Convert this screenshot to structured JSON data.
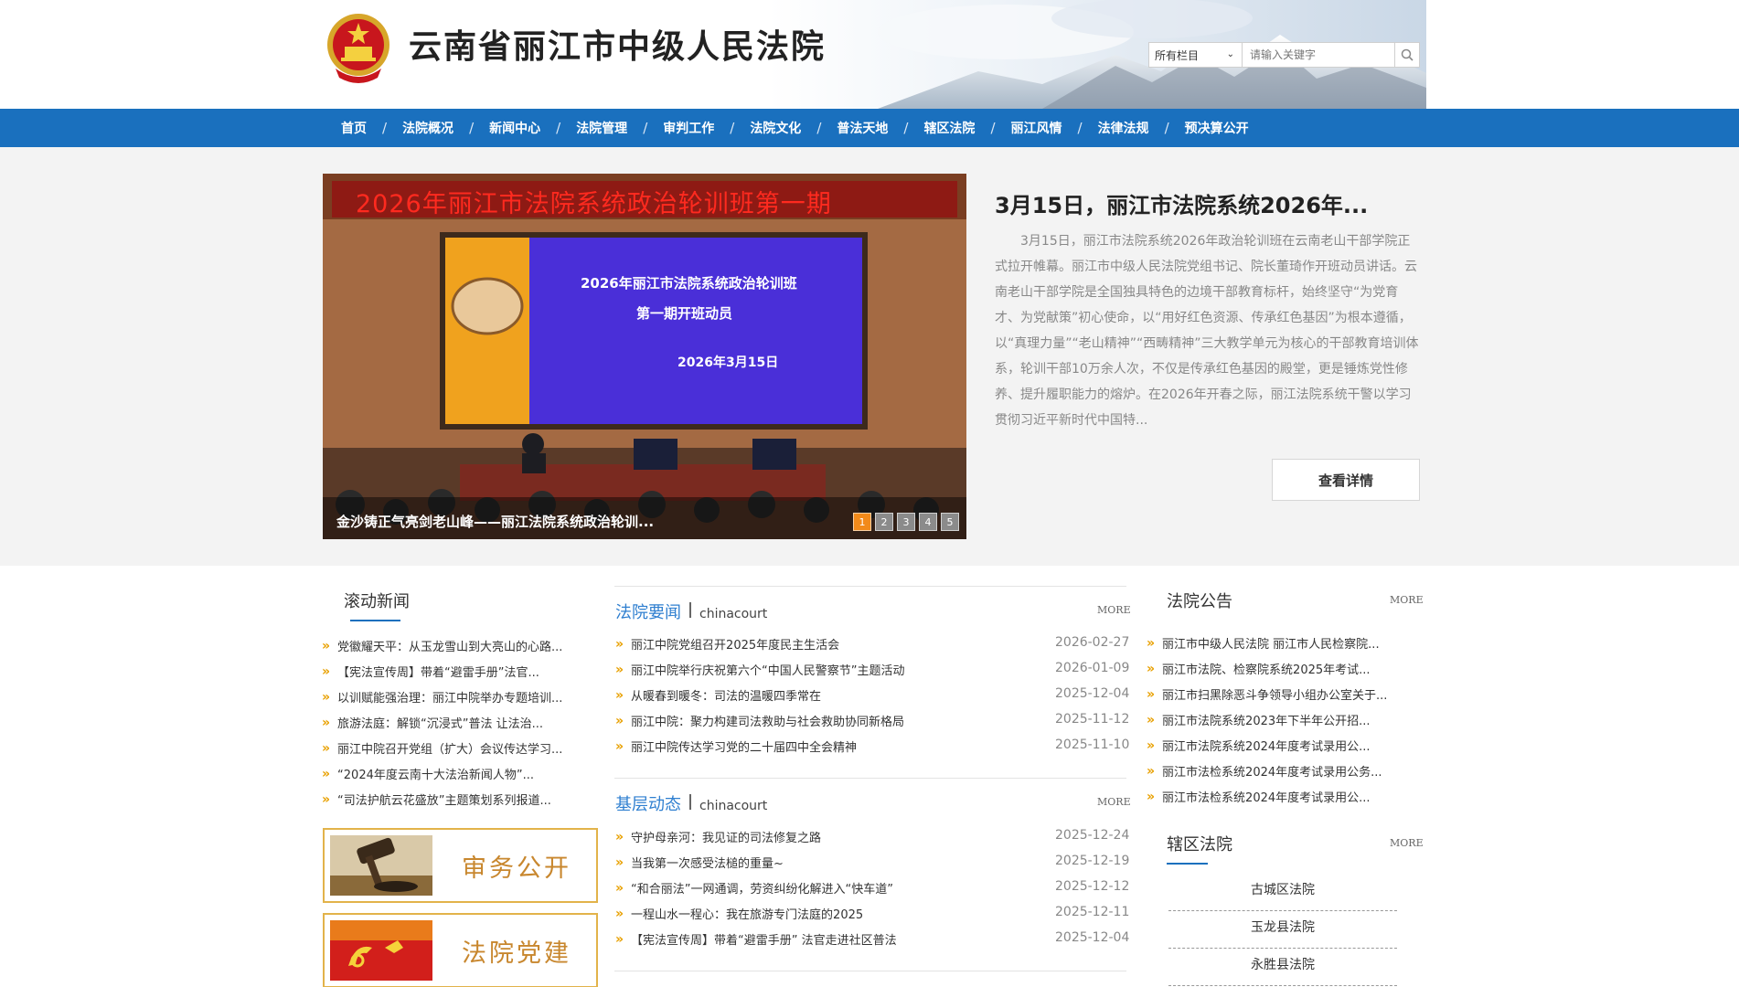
{
  "header": {
    "site_title": "云南省丽江市中级人民法院",
    "search": {
      "category": "所有栏目",
      "placeholder": "请输入关键字"
    }
  },
  "nav": {
    "items": [
      "首页",
      "法院概况",
      "新闻中心",
      "法院管理",
      "审判工作",
      "法院文化",
      "普法天地",
      "辖区法院",
      "丽江风情",
      "法律法规",
      "预决算公开"
    ]
  },
  "featured": {
    "slider": {
      "banner_text": "2026年丽江市法院系统政治轮训班第一期",
      "screen_line1": "2026年丽江市法院系统政治轮训班",
      "screen_line2": "第一期开班动员",
      "screen_date": "2026年3月15日",
      "caption": "金沙铸正气亮剑老山峰——丽江法院系统政治轮训...",
      "pages": [
        "1",
        "2",
        "3",
        "4",
        "5"
      ],
      "active_page": 1
    },
    "title": "3月15日，丽江市法院系统2026年...",
    "body": "3月15日，丽江市法院系统2026年政治轮训班在云南老山干部学院正式拉开帷幕。丽江市中级人民法院党组书记、院长董琦作开班动员讲话。云南老山干部学院是全国独具特色的边境干部教育标杆，始终坚守“为党育才、为党献策”初心使命，以“用好红色资源、传承红色基因”为根本遵循，以“真理力量”“老山精神”“西畴精神”三大教学单元为核心的干部教育培训体系，轮训干部10万余人次，不仅是传承红色基因的殿堂，更是锤炼党性修养、提升履职能力的熔炉。在2026年开春之际，丽江法院系统干警以学习贯彻习近平新时代中国特...",
    "detail_button": "查看详情"
  },
  "scroll_news": {
    "title": "滚动新闻",
    "items": [
      "党徽耀天平：从玉龙雪山到大亮山的心路...",
      "【宪法宣传周】带着“避雷手册”法官...",
      "以训赋能强治理：丽江中院举办专题培训...",
      "旅游法庭：解锁“沉浸式”普法 让法治...",
      "丽江中院召开党组（扩大）会议传达学习...",
      "“2024年度云南十大法治新闻人物”...",
      "“司法护航云花盛放”主题策划系列报道..."
    ]
  },
  "banners": {
    "trial": "审务公开",
    "party": "法院党建"
  },
  "court_news": {
    "title": "法院要闻",
    "subtitle": "chinacourt",
    "more": "MORE",
    "items": [
      {
        "text": "丽江中院党组召开2025年度民主生活会",
        "date": "2026-02-27"
      },
      {
        "text": "丽江中院举行庆祝第六个“中国人民警察节”主题活动",
        "date": "2026-01-09"
      },
      {
        "text": "从暖春到暖冬：司法的温暖四季常在",
        "date": "2025-12-04"
      },
      {
        "text": "丽江中院：聚力构建司法救助与社会救助协同新格局",
        "date": "2025-11-12"
      },
      {
        "text": "丽江中院传达学习党的二十届四中全会精神",
        "date": "2025-11-10"
      }
    ]
  },
  "grassroots": {
    "title": "基层动态",
    "subtitle": "chinacourt",
    "more": "MORE",
    "items": [
      {
        "text": "守护母亲河：我见证的司法修复之路",
        "date": "2025-12-24"
      },
      {
        "text": "当我第一次感受法槌的重量~",
        "date": "2025-12-19"
      },
      {
        "text": "“和合丽法”一网通调，劳资纠纷化解进入“快车道”",
        "date": "2025-12-12"
      },
      {
        "text": "一程山水一程心：我在旅游专门法庭的2025",
        "date": "2025-12-11"
      },
      {
        "text": "【宪法宣传周】带着“避雷手册” 法官走进社区普法",
        "date": "2025-12-04"
      }
    ]
  },
  "notices": {
    "title": "法院公告",
    "more": "MORE",
    "items": [
      "丽江市中级人民法院 丽江市人民检察院...",
      "丽江市法院、检察院系统2025年考试...",
      "丽江市扫黑除恶斗争领导小组办公室关于...",
      "丽江市法院系统2023年下半年公开招...",
      "丽江市法院系统2024年度考试录用公...",
      "丽江市法检系统2024年度考试录用公务...",
      "丽江市法检系统2024年度考试录用公..."
    ]
  },
  "district_courts": {
    "title": "辖区法院",
    "more": "MORE",
    "items": [
      "古城区法院",
      "玉龙县法院",
      "永胜县法院"
    ]
  },
  "colors": {
    "nav_blue": "#1a70be",
    "link_blue": "#2f7fd0",
    "arrow_orange": "#e8a000",
    "banner_border": "#e2b34a"
  }
}
